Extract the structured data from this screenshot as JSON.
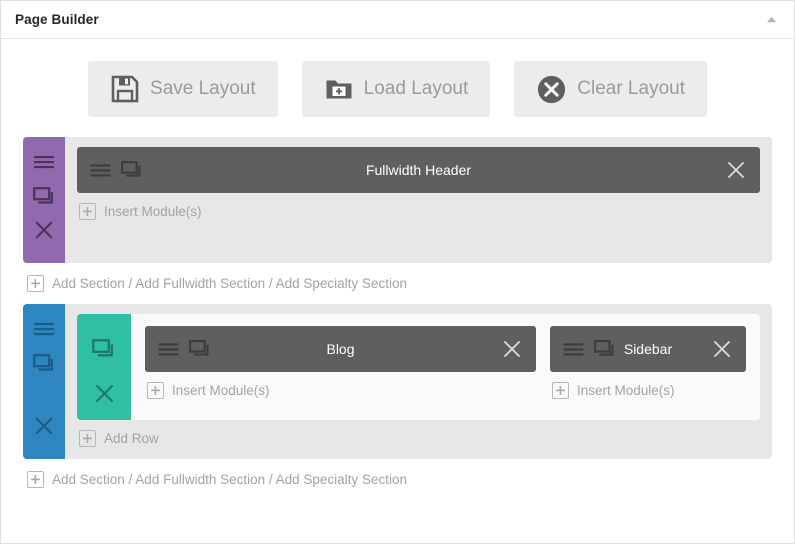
{
  "window": {
    "title": "Page Builder",
    "collapse_icon": "triangle-up-icon"
  },
  "toolbar": {
    "buttons": [
      {
        "label": "Save Layout",
        "icon": "floppy-disk-icon"
      },
      {
        "label": "Load Layout",
        "icon": "folder-plus-icon"
      },
      {
        "label": "Clear Layout",
        "icon": "circle-x-icon"
      }
    ]
  },
  "labels": {
    "insert_modules": "Insert Module(s)",
    "add_row": "Add Row",
    "add_section_line": "Add Section / Add Fullwidth Section / Add Specialty Section"
  },
  "colors": {
    "fullwidth_section_handle": "#9069ae",
    "specialty_section_handle": "#2d86bf",
    "row_handle": "#31bfa4",
    "module_bar": "#5f5f5f",
    "section_background": "#e7e7e7",
    "row_background": "#fafafa",
    "button_background": "#ececec",
    "button_text": "#9b9b9b"
  },
  "sections": [
    {
      "type": "fullwidth",
      "handle_icons": [
        "hamburger-icon",
        "clone-icon",
        "close-icon"
      ],
      "modules": [
        {
          "title": "Fullwidth Header",
          "icons": [
            "hamburger-icon",
            "clone-icon"
          ],
          "close": "close-icon"
        }
      ],
      "insert_label": "Insert Module(s)"
    },
    {
      "type": "specialty",
      "handle_icons": [
        "hamburger-icon",
        "clone-icon",
        "close-icon"
      ],
      "row": {
        "handle_icons": [
          "clone-icon",
          "close-icon"
        ],
        "columns": [
          {
            "width": "wide",
            "module": {
              "title": "Blog",
              "icons": [
                "hamburger-icon",
                "clone-icon"
              ],
              "close": "close-icon"
            },
            "insert_label": "Insert Module(s)"
          },
          {
            "width": "narrow",
            "module": {
              "title": "Sidebar",
              "icons": [
                "hamburger-icon",
                "clone-icon"
              ],
              "close": "close-icon"
            },
            "insert_label": "Insert Module(s)"
          }
        ]
      },
      "add_row_label": "Add Row"
    }
  ],
  "add_section_rows": [
    {
      "label": "Add Section / Add Fullwidth Section / Add Specialty Section"
    },
    {
      "label": "Add Section / Add Fullwidth Section / Add Specialty Section"
    }
  ]
}
